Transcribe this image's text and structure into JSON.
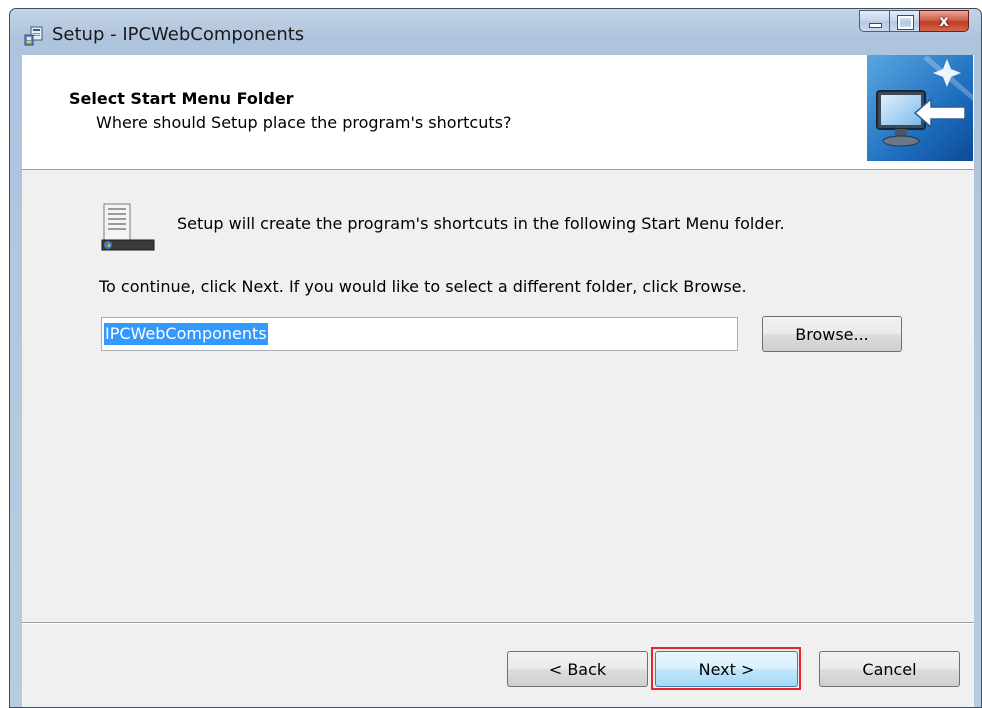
{
  "window": {
    "title": "Setup - IPCWebComponents",
    "icon": "setup-installer-icon"
  },
  "caption_buttons": {
    "minimize_icon": "minimize-icon",
    "maximize_icon": "maximize-icon",
    "close_icon": "close-icon",
    "close_glyph": "x"
  },
  "header": {
    "title": "Select Start Menu Folder",
    "subtitle": "Where should Setup place the program's shortcuts?",
    "image_icon": "monitor-arrow-wizard-icon"
  },
  "body": {
    "folder_icon": "start-menu-folder-icon",
    "info_text": "Setup will create the program's shortcuts in the following Start Menu folder.",
    "instruction_text": "To continue, click Next. If you would like to select a different folder, click Browse."
  },
  "folder_field": {
    "value": "IPCWebComponents",
    "selected": true
  },
  "buttons": {
    "browse": "Browse...",
    "back": "< Back",
    "next": "Next >",
    "cancel": "Cancel"
  },
  "highlight": {
    "target": "next-button",
    "color": "#e5252a"
  },
  "colors": {
    "selection": "#3399ff",
    "title_bar": "#b9cbe0",
    "dialog_background": "#f0f0f0"
  }
}
